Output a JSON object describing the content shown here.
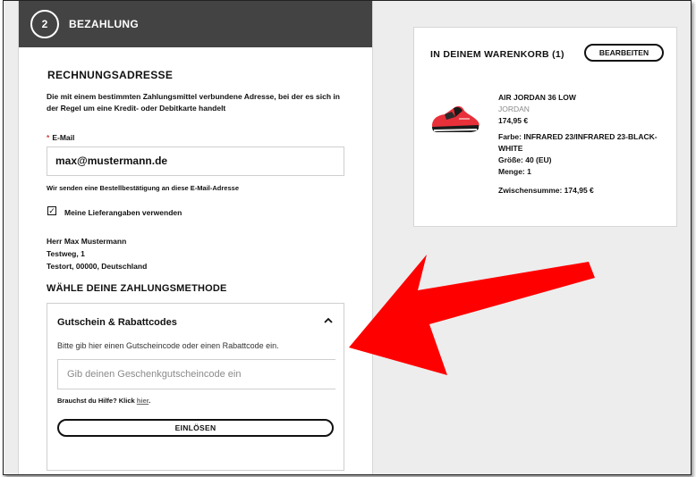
{
  "step": {
    "number": "2",
    "title": "BEZAHLUNG"
  },
  "billing": {
    "title": "RECHNUNGSADRESSE",
    "description": "Die mit einem bestimmten Zahlungsmittel verbundene Adresse, bei der es sich in der Regel um eine Kredit- oder Debitkarte handelt",
    "email_required_mark": "*",
    "email_label": "E-Mail",
    "email_value": "max@mustermann.de",
    "email_note": "Wir senden eine Bestellbestätigung an diese E-Mail-Adresse",
    "use_delivery_checked": true,
    "use_delivery_label": "Meine Lieferangaben verwenden",
    "address": [
      "Herr Max Mustermann",
      "Testweg, 1",
      "Testort, 00000, Deutschland"
    ]
  },
  "payment": {
    "title": "WÄHLE DEINE ZAHLUNGSMETHODE",
    "voucher": {
      "heading": "Gutschein & Rabattcodes",
      "description": "Bitte gib hier einen Gutscheincode oder einen Rabattcode ein.",
      "placeholder": "Gib deinen Geschenkgutscheincode ein",
      "help_text": "Brauchst du Hilfe? Klick",
      "help_link": "hier",
      "help_end": ".",
      "redeem_label": "EINLÖSEN"
    }
  },
  "cart": {
    "title": "IN DEINEM WARENKORB (1)",
    "edit_label": "BEARBEITEN",
    "item": {
      "name": "AIR JORDAN 36 LOW",
      "brand": "JORDAN",
      "price": "174,95 €",
      "color": "Farbe: INFRARED 23/INFRARED 23-BLACK-WHITE",
      "size": "Größe: 40 (EU)",
      "quantity": "Menge: 1",
      "subtotal": "Zwischensumme: 174,95 €"
    }
  },
  "colors": {
    "header_bg": "#434343",
    "arrow": "#ff0000",
    "shoe_red": "#e8303a"
  }
}
